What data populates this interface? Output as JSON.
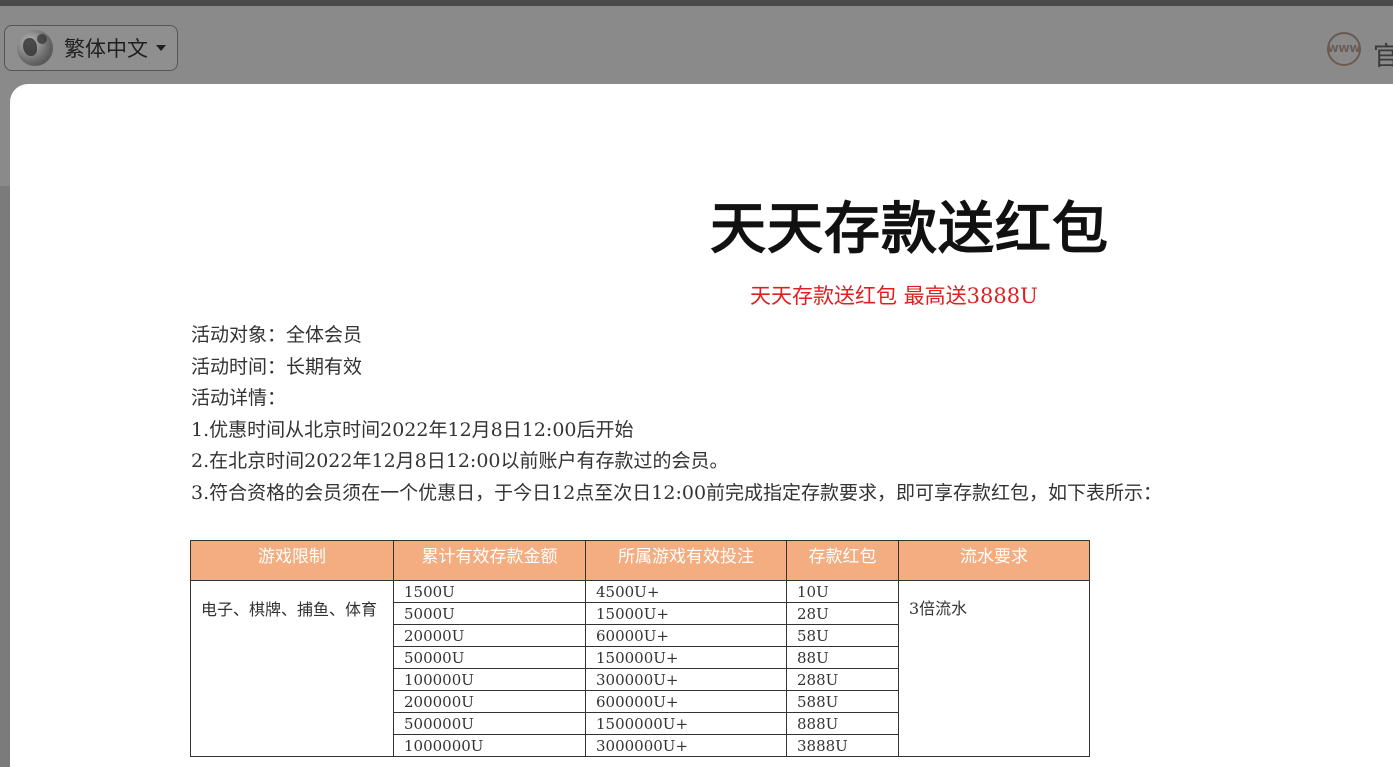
{
  "header": {
    "language_label": "繁体中文",
    "official_label": "官",
    "globe_icon": "globe-icon",
    "www_icon": "www-icon",
    "www_text": "WWW"
  },
  "promo": {
    "title": "天天存款送红包",
    "subtitle": "天天存款送红包  最高送3888U",
    "subtitle_color": "#e02020",
    "lines": [
      "活动对象：全体会员",
      "活动时间：长期有效",
      "活动详情：",
      "1.优惠时间从北京时间2022年12月8日12:00后开始",
      "2.在北京时间2022年12月8日12:00以前账户有存款过的会员。",
      "3.符合资格的会员须在一个优惠日，于今日12点至次日12:00前完成指定存款要求，即可享存款红包，如下表所示："
    ]
  },
  "table": {
    "header_color": "#f4ad80",
    "headers": [
      "游戏限制",
      "累计有效存款金额",
      "所属游戏有效投注",
      "存款红包",
      "流水要求"
    ],
    "game_limit": "电子、棋牌、捕鱼、体育",
    "flow_requirement": "3倍流水",
    "rows": [
      {
        "deposit": "1500U",
        "bet": "4500U+",
        "bonus": "10U"
      },
      {
        "deposit": "5000U",
        "bet": "15000U+",
        "bonus": "28U"
      },
      {
        "deposit": "20000U",
        "bet": "60000U+",
        "bonus": "58U"
      },
      {
        "deposit": "50000U",
        "bet": "150000U+",
        "bonus": "88U"
      },
      {
        "deposit": "100000U",
        "bet": "300000U+",
        "bonus": "288U"
      },
      {
        "deposit": "200000U",
        "bet": "600000U+",
        "bonus": "588U"
      },
      {
        "deposit": "500000U",
        "bet": "1500000U+",
        "bonus": "888U"
      },
      {
        "deposit": "1000000U",
        "bet": "3000000U+",
        "bonus": "3888U"
      }
    ]
  }
}
